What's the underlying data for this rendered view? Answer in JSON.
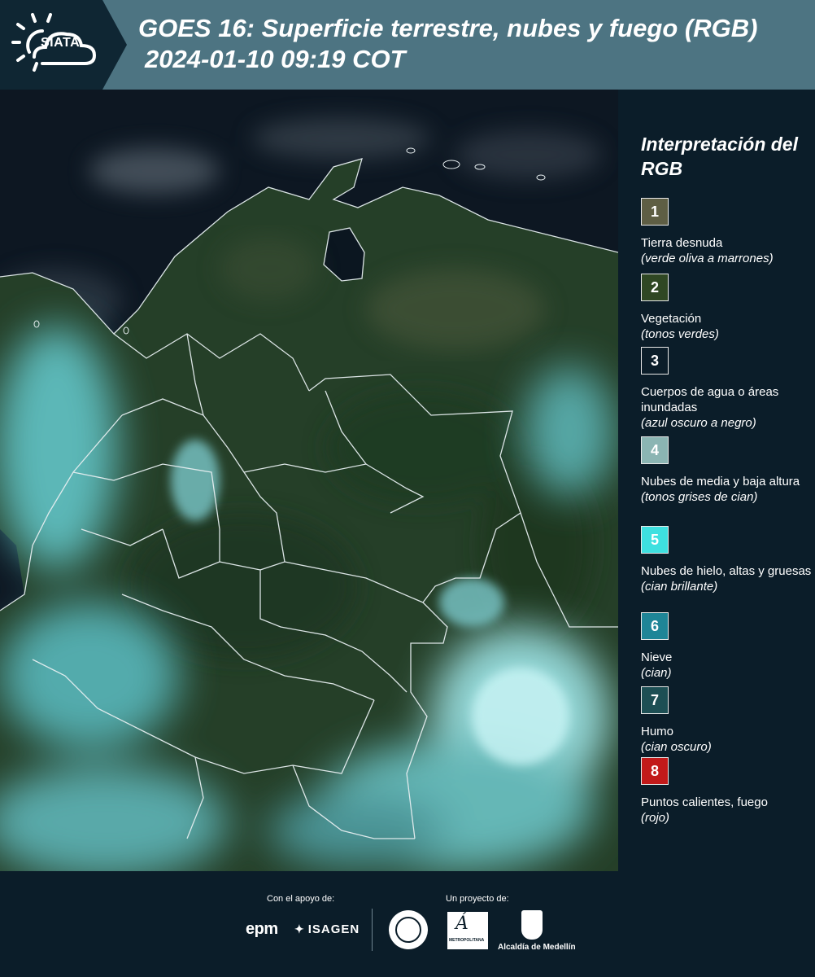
{
  "header": {
    "logo_text": "SIATA",
    "title": "GOES 16: Superficie terrestre, nubes y fuego (RGB)",
    "subtitle": "2024-01-10 09:19 COT"
  },
  "map": {
    "product": "GOES 16 RGB composite",
    "colors": {
      "vegetation": "#253f28",
      "ocean": "#0d1722",
      "cloud": "#7fd9d8",
      "border": "#e6eef0"
    }
  },
  "legend": {
    "title": "Interpretación del RGB",
    "items": [
      {
        "number": "1",
        "color": "#5e5e44",
        "label": "Tierra desnuda",
        "desc": "(verde oliva a marrones)"
      },
      {
        "number": "2",
        "color": "#2f4723",
        "label": "Vegetación",
        "desc": "(tonos verdes)"
      },
      {
        "number": "3",
        "color": "#0b1d29",
        "label": "Cuerpos de agua o áreas inundadas",
        "desc": "(azul oscuro a negro)"
      },
      {
        "number": "4",
        "color": "#8bb5b3",
        "label": "Nubes de media y baja altura",
        "desc": "(tonos grises de cian)"
      },
      {
        "number": "5",
        "color": "#3ee0e0",
        "label": "Nubes de hielo, altas y gruesas",
        "desc": "(cian brillante)"
      },
      {
        "number": "6",
        "color": "#1f8597",
        "label": "Nieve",
        "desc": "(cian)"
      },
      {
        "number": "7",
        "color": "#1d4f54",
        "label": "Humo",
        "desc": "(cian oscuro)"
      },
      {
        "number": "8",
        "color": "#c21a1a",
        "label": "Puntos calientes, fuego",
        "desc": "(rojo)"
      }
    ]
  },
  "footer": {
    "support_label": "Con el apoyo de:",
    "project_label": "Un proyecto de:",
    "sponsors": [
      "epm",
      "ISAGEN"
    ],
    "partners": [
      "Área Metropolitana Valle de Aburrá",
      "Alcaldía de Medellín"
    ],
    "medellin_label": "Alcaldía de Medellín"
  }
}
